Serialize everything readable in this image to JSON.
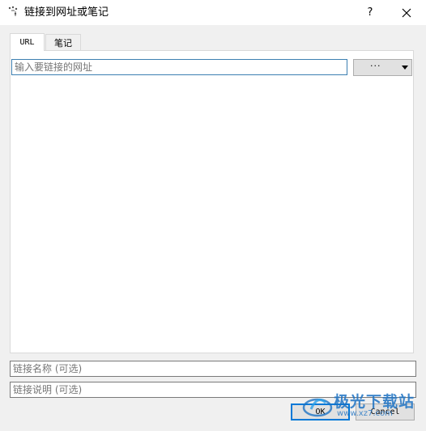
{
  "window": {
    "title": "链接到网址或笔记",
    "help_label": "?",
    "app_icon": "link-dots-icon",
    "close_icon": "close-icon"
  },
  "tabs": [
    {
      "label": "URL",
      "selected": true
    },
    {
      "label": "笔记",
      "selected": false
    }
  ],
  "url_input": {
    "placeholder": "输入要链接的网址",
    "value": ""
  },
  "dropdown": {
    "label": "···",
    "icon": "dropdown-arrow-icon"
  },
  "name_field": {
    "placeholder": "链接名称 (可选)",
    "value": ""
  },
  "desc_field": {
    "placeholder": "链接说明 (可选)",
    "value": ""
  },
  "buttons": {
    "ok": "OK",
    "cancel": "Cancel"
  },
  "watermark": {
    "text": "极光下载站",
    "sub": "www.xz7.com"
  },
  "colors": {
    "focus_border": "#3c7fb1",
    "ok_border": "#0078d7",
    "watermark": "#1e73c4"
  }
}
